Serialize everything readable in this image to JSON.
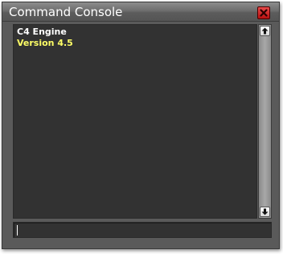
{
  "window": {
    "title": "Command Console"
  },
  "console": {
    "lines": [
      {
        "text": "C4 Engine",
        "color": "#ffffff"
      },
      {
        "text": "Version 4.5",
        "color": "#ffff66"
      }
    ]
  },
  "input": {
    "value": ""
  },
  "icons": {
    "close": "close-icon",
    "scroll_up": "arrow-up-icon",
    "scroll_down": "arrow-down-icon"
  }
}
